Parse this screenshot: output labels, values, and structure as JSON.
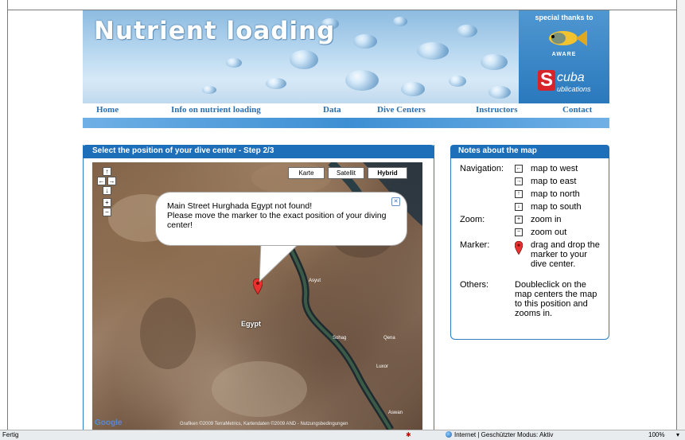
{
  "banner": {
    "title": "Nutrient loading",
    "thanks": "special thanks to",
    "aware": "AWARE",
    "sponsor_letter": "S",
    "sponsor_word": "cuba",
    "sponsor_sub": "ublications"
  },
  "nav": {
    "items": [
      "Home",
      "Info on nutrient loading",
      "Data",
      "Dive Centers",
      "Instructors",
      "Contact"
    ]
  },
  "left_panel": {
    "title": "Select the position of your dive center - Step 2/3",
    "map_types": [
      "Karte",
      "Satellit",
      "Hybrid"
    ],
    "active_map_type": "Hybrid",
    "infowindow": "Main Street Hurghada Egypt not found!\nPlease move the marker to the exact position of your diving center!",
    "country_label": "Egypt",
    "cities": [
      "Asyut",
      "Sohag",
      "Qena",
      "Luxor",
      "Aswan"
    ],
    "copyright": "Grafiken ©2009 TerraMetrics, Kartendaten ©2009 AND - Nutzungsbedingungen",
    "google": "Google"
  },
  "notes": {
    "title": "Notes about the map",
    "navigation_label": "Navigation:",
    "nav_items": [
      "map to west",
      "map to east",
      "map to north",
      "map to south"
    ],
    "zoom_label": "Zoom:",
    "zoom_items": [
      "zoom in",
      "zoom out"
    ],
    "marker_label": "Marker:",
    "marker_text": "drag and drop the marker to your dive center.",
    "others_label": "Others:",
    "others_text": "Doubleclick on the map centers the map to this position and zooms in."
  },
  "status": {
    "left": "Fertig",
    "zone": "Internet | Geschützter Modus: Aktiv",
    "zoom": "100%"
  }
}
